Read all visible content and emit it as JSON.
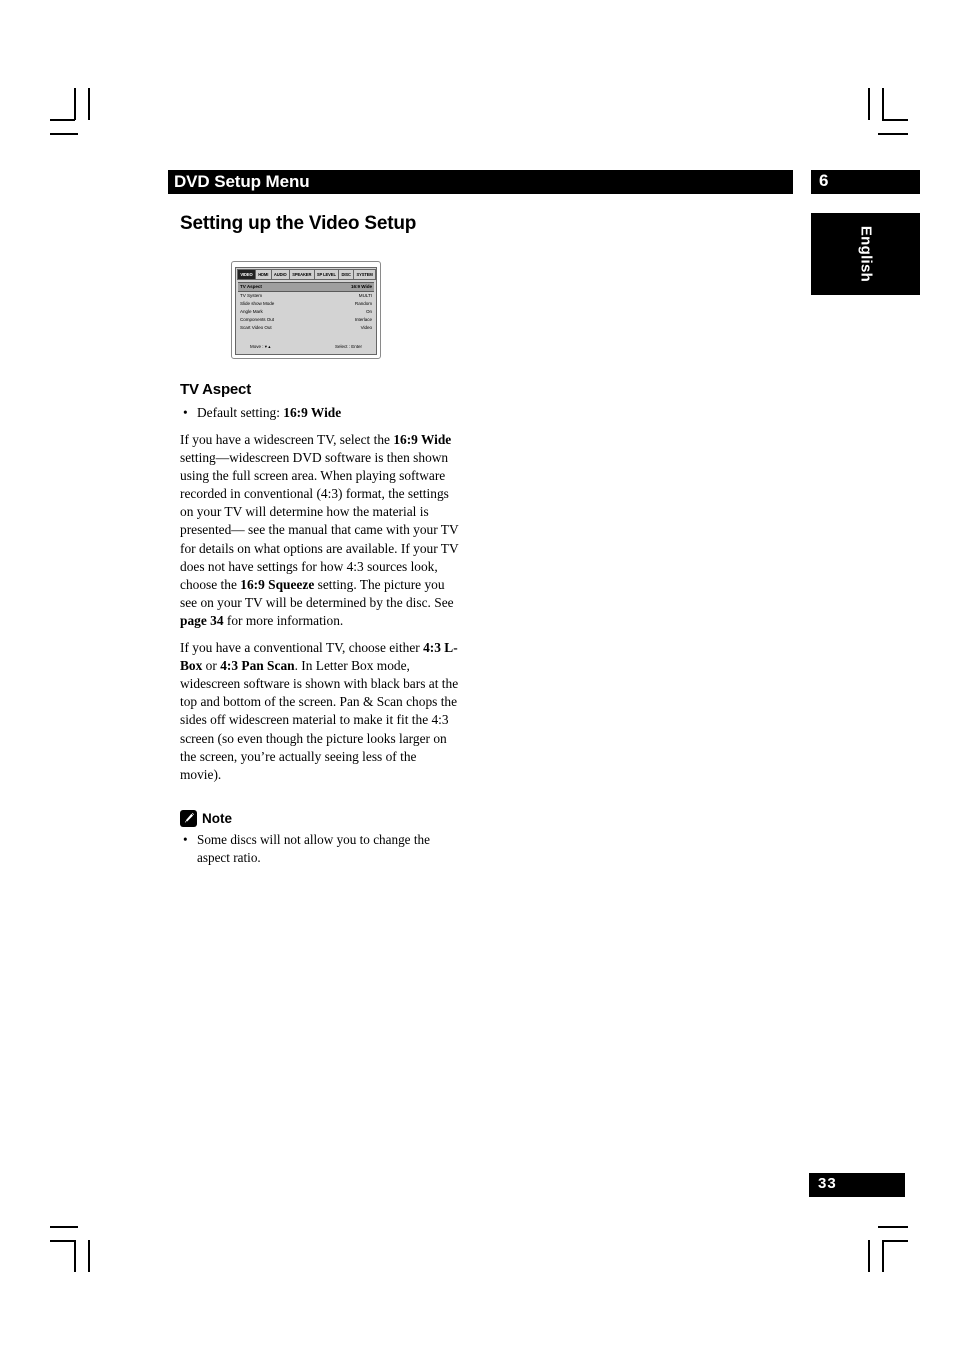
{
  "header": {
    "title": "DVD Setup Menu",
    "chapter_number": "6",
    "language_tab": "English",
    "page_heading": "Setting up the Video Setup"
  },
  "osd_screen": {
    "tabs": [
      {
        "label": "VIDEO",
        "selected": true
      },
      {
        "label": "HDMI",
        "selected": false
      },
      {
        "label": "AUDIO",
        "selected": false
      },
      {
        "label": "SPEAKER",
        "selected": false
      },
      {
        "label": "SP LEVEL",
        "selected": false
      },
      {
        "label": "DISC",
        "selected": false
      },
      {
        "label": "SYSTEM",
        "selected": false
      }
    ],
    "rows": [
      {
        "label": "TV Aspect",
        "value": "16:9 Wide",
        "highlight": true
      },
      {
        "label": "TV System",
        "value": "MULTI",
        "highlight": false
      },
      {
        "label": "Slide show Mode",
        "value": "Random",
        "highlight": false
      },
      {
        "label": "Angle Mark",
        "value": "On",
        "highlight": false
      },
      {
        "label": "Components Out",
        "value": "Interlace",
        "highlight": false
      },
      {
        "label": "Scart Video Out",
        "value": "Video",
        "highlight": false
      }
    ],
    "hint_move": "Move :  ▾ ▴",
    "hint_select": "Select : Enter"
  },
  "content": {
    "section_title": "TV Aspect",
    "default_setting_prefix": "Default setting: ",
    "default_setting_value": "16:9 Wide",
    "bullet_dot": "•",
    "paragraph1": {
      "part1": "If you have a widescreen TV, select the ",
      "bold1": "16:9 Wide",
      "part2": " setting—widescreen DVD software is then shown using the full screen area. When playing software recorded in conventional (4:3) format, the settings on your TV will determine how the material is presented— see the manual that came with your TV for details on what options are available. If your TV does not have settings for how 4:3 sources look, choose the ",
      "bold2": "16:9 Squeeze",
      "part3": " setting. The picture you see on your TV will be determined by the disc. See ",
      "bold3": "page 34",
      "part4": " for more information."
    },
    "paragraph2": {
      "part1": "If you have a conventional TV, choose either ",
      "bold1": "4:3 L-Box",
      "part2": " or ",
      "bold2": "4:3 Pan Scan",
      "part3": ". In Letter Box mode, widescreen software is shown with black bars at the top and bottom of the screen. Pan & Scan chops the sides off widescreen material to make it fit the 4:3 screen (so even though the picture looks larger on the screen, you’re actually seeing less of the movie)."
    }
  },
  "note": {
    "label": "Note",
    "icon": "pencil-icon",
    "bullet_dot": "•",
    "text": "Some discs will not allow you to change the aspect ratio."
  },
  "footer": {
    "page_number": "33"
  },
  "colors": {
    "bar_black": "#000000",
    "bar_text": "#ffffff",
    "osd_background": "#d3d3d3",
    "osd_highlight": "#9f9f9f",
    "page_background": "#ffffff"
  }
}
